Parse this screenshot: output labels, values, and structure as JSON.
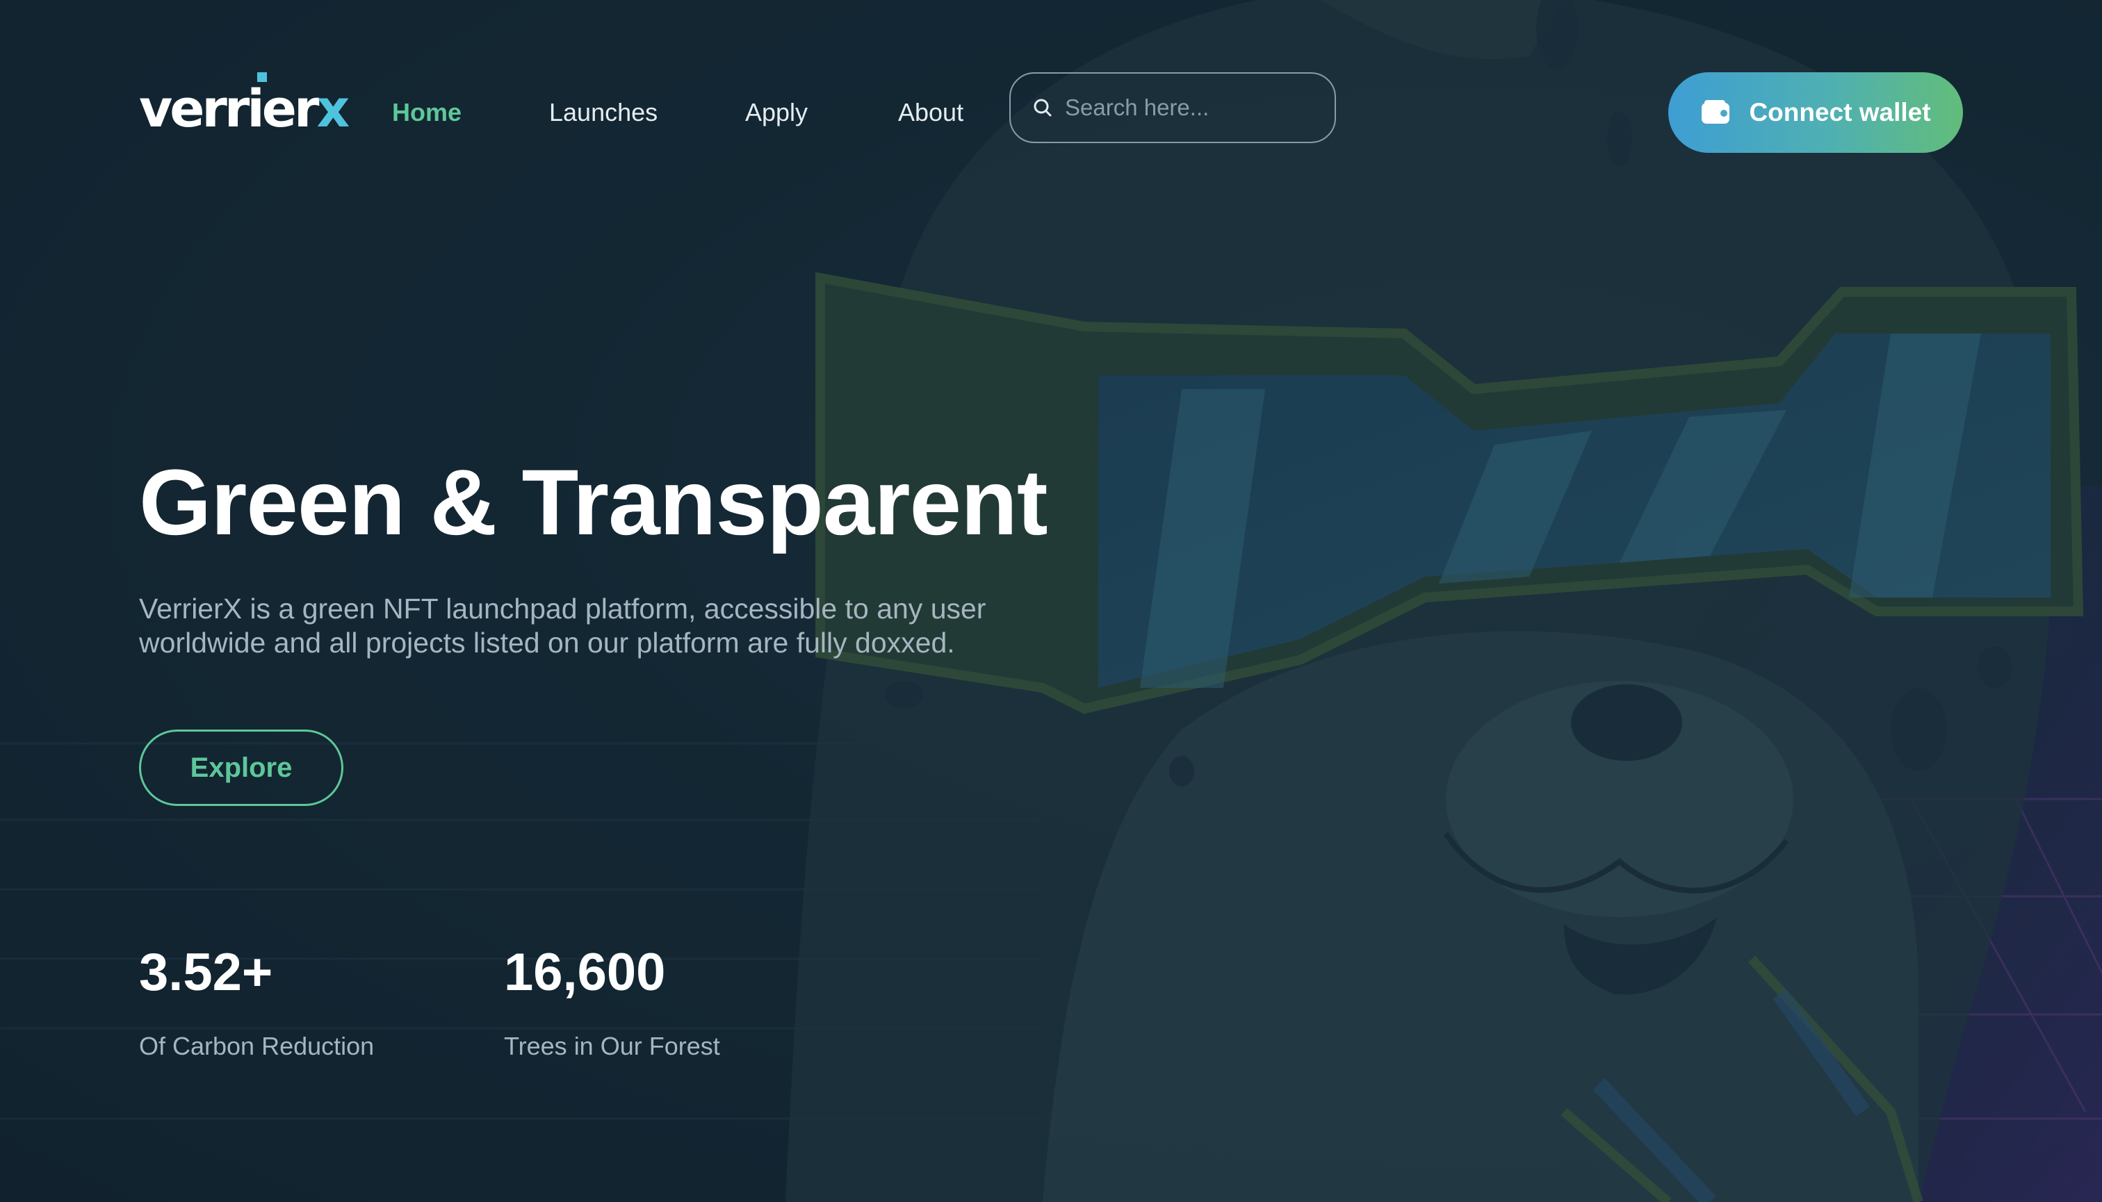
{
  "brand": {
    "logo_main": "verrier",
    "logo_accent": "x"
  },
  "nav": {
    "items": [
      {
        "label": "Home",
        "active": true
      },
      {
        "label": "Launches",
        "active": false
      },
      {
        "label": "Apply",
        "active": false
      },
      {
        "label": "About",
        "active": false
      }
    ]
  },
  "search": {
    "placeholder": "Search here..."
  },
  "wallet": {
    "connect_label": "Connect wallet",
    "icon": "wallet-icon"
  },
  "hero": {
    "title": "Green & Transparent",
    "subtitle": "VerrierX is a green NFT launchpad platform, accessible to any user worldwide and all projects listed on our platform are fully doxxed.",
    "explore_label": "Explore"
  },
  "stats": [
    {
      "value": "3.52+",
      "label": "Of Carbon Reduction"
    },
    {
      "value": "16,600",
      "label": "Trees in Our Forest"
    }
  ],
  "colors": {
    "background": "#132632",
    "accent_green": "#5ec79a",
    "accent_blue": "#4fc3dd",
    "button_gradient_start": "#3e9ed3",
    "button_gradient_end": "#62bd7a",
    "text_muted": "#a6b6c0"
  }
}
